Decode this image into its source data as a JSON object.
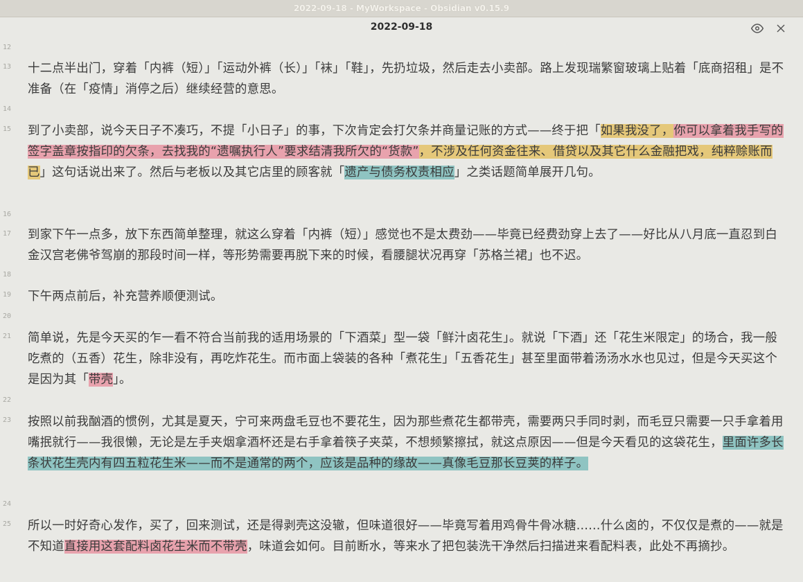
{
  "window": {
    "title": "2022-09-18 - MyWorkspace - Obsidian v0.15.9"
  },
  "header": {
    "note_title": "2022-09-18"
  },
  "icons": {
    "preview": "eye-icon",
    "close": "close-icon"
  },
  "colors": {
    "pink": "#e8a2ad",
    "yellow": "#e5c87a",
    "teal": "#8fc4c2"
  },
  "lines": [
    {
      "num": "12"
    },
    {
      "num": "13",
      "segments": [
        {
          "t": "十二点半出门，穿着「内裤（短）」「运动外裤（长）」「袜」「鞋」，先扔垃圾，然后走去小卖部。路上发现瑞繁窗玻璃上贴着「底商招租」是不准备（在「疫情」消停之后）继续经营的意思。"
        }
      ]
    },
    {
      "num": "14"
    },
    {
      "num": "15",
      "segments": [
        {
          "t": "到了小卖部，说今天日子不凑巧，不提「小日子」的事，下次肯定会打欠条并商量记账的方式——终于把「"
        },
        {
          "t": "如果我没了，",
          "hl": "yellow"
        },
        {
          "t": "你可以拿着我手写的签字盖章按指印的欠条，去找我的“遗嘱执行人”要求结清我所欠的“货款”",
          "hl": "pink"
        },
        {
          "t": "，不涉及任何资金往来、借贷以及其它什么金融把戏，纯粹赊账而已",
          "hl": "yellow"
        },
        {
          "t": "」这句话说出来了。然后与老板以及其它店里的顾客就「"
        },
        {
          "t": "遗产与债务权责相应",
          "hl": "teal"
        },
        {
          "t": "」之类话题简单展开几句。"
        }
      ]
    },
    {
      "num": "16"
    },
    {
      "num": "17",
      "segments": [
        {
          "t": "到家下午一点多，放下东西简单整理，就这么穿着「内裤（短）」感觉也不是太费劲——毕竟已经费劲穿上去了——好比从八月底一直忍到白金汉宫老佛爷驾崩的那段时间一样，等形势需要再脱下来的时候，看腰腿状况再穿「苏格兰裙」也不迟。"
        }
      ]
    },
    {
      "num": "18"
    },
    {
      "num": "19",
      "segments": [
        {
          "t": "下午两点前后，补充营养顺便测试。"
        }
      ]
    },
    {
      "num": "20"
    },
    {
      "num": "21",
      "segments": [
        {
          "t": "简单说，先是今天买的乍一看不符合当前我的适用场景的「下酒菜」型一袋「鲜汁卤花生」。就说「下酒」还「花生米限定」的场合，我一般吃煮的（五香）花生，除非没有，再吃炸花生。而市面上袋装的各种「煮花生」「五香花生」甚至里面带着汤汤水水也见过，但是今天买这个是因为其「"
        },
        {
          "t": "带壳",
          "hl": "pink"
        },
        {
          "t": "」。"
        }
      ]
    },
    {
      "num": "22"
    },
    {
      "num": "23",
      "segments": [
        {
          "t": "按照以前我酗酒的惯例，尤其是夏天，宁可来两盘毛豆也不要花生，因为那些煮花生都带壳，需要两只手同时剥，而毛豆只需要一只手拿着用嘴抿就行——我很懒，无论是左手夹烟拿酒杯还是右手拿着筷子夹菜，不想频繁擦拭，就这点原因——但是今天看见的这袋花生，"
        },
        {
          "t": "里面许多长条状花生壳内有四五粒花生米——而不是通常的两个，应该是品种的缘故——真像毛豆那长豆荚的样子。",
          "hl": "teal"
        }
      ]
    },
    {
      "num": "24"
    },
    {
      "num": "25",
      "segments": [
        {
          "t": "所以一时好奇心发作，买了，回来测试，还是得剥壳这没辙，但味道很好——毕竟写着用鸡骨牛骨冰糖……什么卤的，不仅仅是煮的——就是不知道"
        },
        {
          "t": "直接用这套配料卤花生米而不带壳",
          "hl": "pink"
        },
        {
          "t": "，味道会如何。目前断水，等来水了把包装洗干净然后扫描进来看配料表，此处不再摘抄。"
        }
      ]
    }
  ]
}
